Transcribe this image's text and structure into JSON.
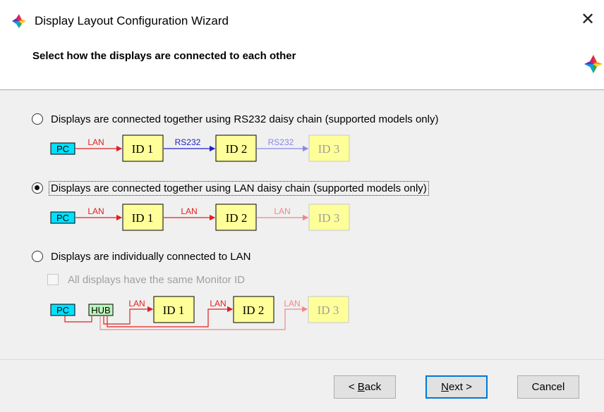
{
  "window": {
    "title": "Display Layout Configuration Wizard",
    "close_glyph": "✕"
  },
  "header": {
    "title": "Select how the displays are connected to each other"
  },
  "options": [
    {
      "label": "Displays are connected together using RS232 daisy chain (supported models only)",
      "selected": false
    },
    {
      "label": "Displays are connected together using LAN daisy chain (supported models only)",
      "selected": true
    },
    {
      "label": "Displays are individually connected to LAN",
      "selected": false
    }
  ],
  "same_id_checkbox": {
    "label": "All displays have the same Monitor ID",
    "checked": false,
    "enabled": false
  },
  "diagrams": {
    "rs232": {
      "pc": "PC",
      "link1": "LAN",
      "id1": "ID 1",
      "link2": "RS232",
      "id2": "ID 2",
      "link3": "RS232",
      "id3": "ID 3"
    },
    "lan": {
      "pc": "PC",
      "link1": "LAN",
      "id1": "ID 1",
      "link2": "LAN",
      "id2": "ID 2",
      "link3": "LAN",
      "id3": "ID 3"
    },
    "hub": {
      "pc": "PC",
      "hub": "HUB",
      "link1": "LAN",
      "id1": "ID 1",
      "link2": "LAN",
      "id2": "ID 2",
      "link3": "LAN",
      "id3": "ID 3"
    }
  },
  "buttons": {
    "back": {
      "pre": "< ",
      "mnemonic": "B",
      "post": "ack"
    },
    "next": {
      "pre": "",
      "mnemonic": "N",
      "post": "ext >"
    },
    "cancel": "Cancel"
  },
  "colors": {
    "pc_box": "#00e0ff",
    "id_box": "#ffff99",
    "hub_box": "#bdf5bd",
    "lan": "#e02020",
    "lan_faded": "#f08888",
    "rs232": "#2020c8",
    "rs232_faded": "#8888e8",
    "default_button_border": "#0078d7"
  }
}
